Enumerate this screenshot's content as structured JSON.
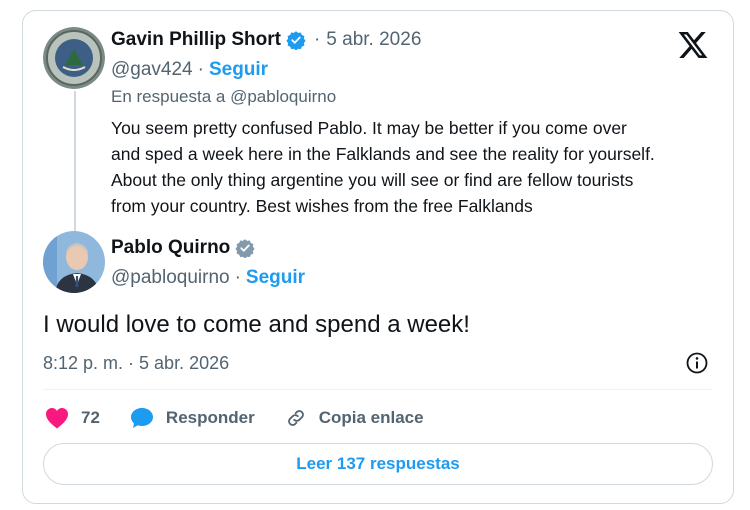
{
  "quoted_tweet": {
    "author_name": "Gavin Phillip Short",
    "verified": true,
    "date_separator": "·",
    "date": "5 abr. 2026",
    "handle": "@gav424",
    "follow_separator": "·",
    "follow_label": "Seguir",
    "reply_to": "En respuesta a @pabloquirno",
    "text_lines": [
      "You seem pretty confused Pablo. It may be better if you come over",
      "and sped a week here in the Falklands and see the reality for yourself.",
      "About the only thing argentine you will see or find are fellow tourists",
      "from your country. Best wishes from the free Falklands"
    ]
  },
  "main_tweet": {
    "author_name": "Pablo Quirno",
    "verified": true,
    "handle": "@pabloquirno",
    "follow_separator": "·",
    "follow_label": "Seguir",
    "text": "I would love to come and spend a week!",
    "timestamp": "8:12 p. m. · 5 abr. 2026"
  },
  "actions": {
    "likes_count": "72",
    "reply_label": "Responder",
    "copy_link_label": "Copia enlace"
  },
  "read_replies_label": "Leer 137 respuestas",
  "colors": {
    "accent": "#1d9bf0",
    "like": "#f91880",
    "text": "#0f1419",
    "muted": "#536471",
    "border": "#cfd9de"
  },
  "icons": {
    "brand": "x-logo-icon",
    "verified": "verified-badge-icon",
    "info": "info-icon",
    "like": "heart-icon",
    "reply": "reply-bubble-icon",
    "copy": "link-icon"
  }
}
